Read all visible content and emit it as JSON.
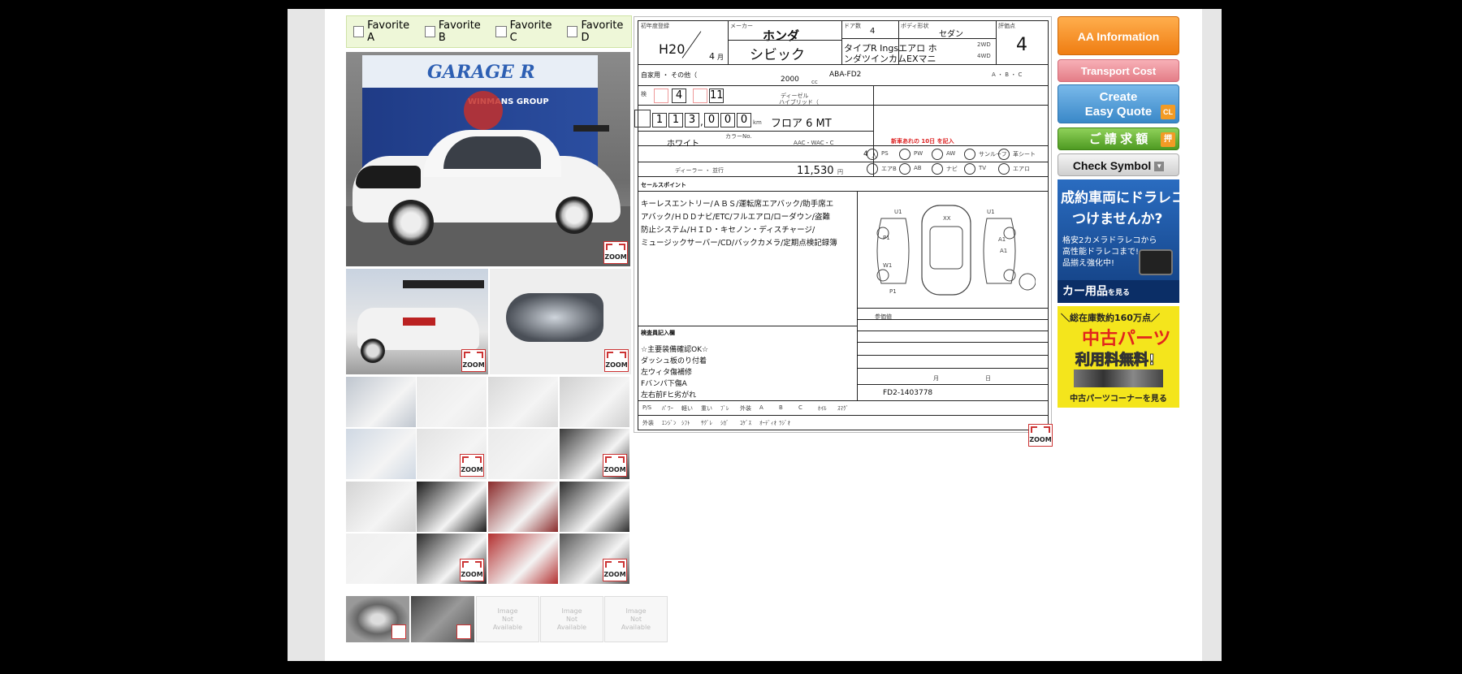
{
  "favorites": [
    "Favorite A",
    "Favorite B",
    "Favorite C",
    "Favorite D"
  ],
  "photos": {
    "zoom_label": "ZOOM",
    "main_signage": "GARAGE R",
    "main_sub": "WINMANS GROUP",
    "not_available": "Image\nNot\nAvailable"
  },
  "sheet": {
    "era_year": "H20",
    "month": "4",
    "month_unit": "月",
    "maker": "ホンダ",
    "model": "シビック",
    "doors": "4",
    "body": "セダン",
    "grade": "タイプR Ingsエアロ ホンダツインカムEXマニ",
    "grade_line1": "タイプR Ingsエアロ ホ",
    "grade_line2": "ンダツインカムEXマニ",
    "drive_2wd": "2WD",
    "drive_4wd": "4WD",
    "score": "4",
    "usage": "自家用 ・ その他（",
    "displacement": "2000",
    "displacement_unit": "cc",
    "model_code": "ABA-FD2",
    "fuel": "ディーゼル",
    "hybrid": "ハイブリッド（",
    "grade_letters": "A ・ B ・ C",
    "inspection_month": "4",
    "inspection_day": "11",
    "inspection_label": "検",
    "mileage_digits": [
      "1",
      "1",
      "3",
      "0",
      "0",
      "0"
    ],
    "mileage_comma": ",",
    "mileage_unit": "km",
    "shift": "フロア 6  MT",
    "color": "ホワイト",
    "color_label": "カラーNo.",
    "ac": "AAC・WAC・C",
    "capacity": "4",
    "capacity_unit": "人",
    "dealer": "ディーラー ・ 並行",
    "price": "11,530",
    "price_unit": "円",
    "red_note": "新車あれの 10日 を記入",
    "equip_row1": [
      "PS",
      "PW",
      "AW",
      "サンルーフ",
      "革シート"
    ],
    "equip_row2": [
      "エアB",
      "AB",
      "ナビ",
      "TV",
      "エアロ"
    ],
    "sales_point_label": "セールスポイント",
    "sales_points": [
      "キーレスエントリー/ＡＢＳ/運転席エアバック/助手席エ",
      "アバック/ＨＤＤナビ/ETC/フルエアロ/ローダウン/盗難",
      "防止システム/ＨＩＤ・キセノン・ディスチャージ/",
      "ミュージックサーバー/CD/バックカメラ/定期点検記録簿"
    ],
    "inspector_label": "検査員記入欄",
    "inspector_notes": [
      "☆主要装備確認OK☆",
      "ダッシュ板のり付着",
      "左ウィタ傷補修",
      "Fバンパ下傷A",
      "左右前Fヒ劣がれ"
    ],
    "diagram_marks": [
      "XX",
      "U1",
      "U1",
      "P1",
      "A1",
      "A1",
      "W1",
      "P1"
    ],
    "reference_label": "参価値",
    "serial": "FD2-1403778",
    "month_label": "月",
    "day_label": "日",
    "bottom_row1": [
      "P/S",
      "ﾊﾟﾜｰ",
      "軽い",
      "重い",
      "ﾌﾞﾚ",
      "外装",
      "A",
      "B",
      "C",
      "ﾎｲﾙ",
      "ｽﾏｸﾞ"
    ],
    "bottom_row2": [
      "外装",
      "ｴﾝｼﾞﾝ",
      "ｼﾌﾄ",
      "ｻｸﾞﾚ",
      "ｼｶﾞ",
      "ｺｹﾞｽ",
      "ｵｰﾃﾞｨｵ",
      "ﾗｼﾞｵ"
    ]
  },
  "buttons": {
    "aa_info": "AA Information",
    "transport": "Transport Cost",
    "quote_line1": "Create",
    "quote_line2": "Easy Quote",
    "quote_badge": "CL",
    "invoice": "ご 請 求 額",
    "invoice_badge": "押",
    "check_symbol": "Check Symbol"
  },
  "banners": {
    "drive_line1": "成約車両にドラレコ",
    "drive_line2": "つけませんか?",
    "drive_line3": "格安2カメラドラレコから",
    "drive_line4": "高性能ドラレコまで!",
    "drive_line5": "品揃え強化中!",
    "drive_footer": "カー用品",
    "drive_footer_small": "を見る",
    "parts_line1": "＼総在庫数約160万点／",
    "parts_line2": "中古パーツ",
    "parts_line3": "利用料無料!",
    "parts_footer": "中古パーツコーナーを見る"
  },
  "colors": {
    "aa_info": "#f28a1f",
    "transport": "#e98e96",
    "quote": "#4b9bd6",
    "invoice": "#6db33f",
    "check": "#d9d9d9",
    "drive_banner": "#1e5ba8",
    "parts_banner": "#f3e317"
  }
}
